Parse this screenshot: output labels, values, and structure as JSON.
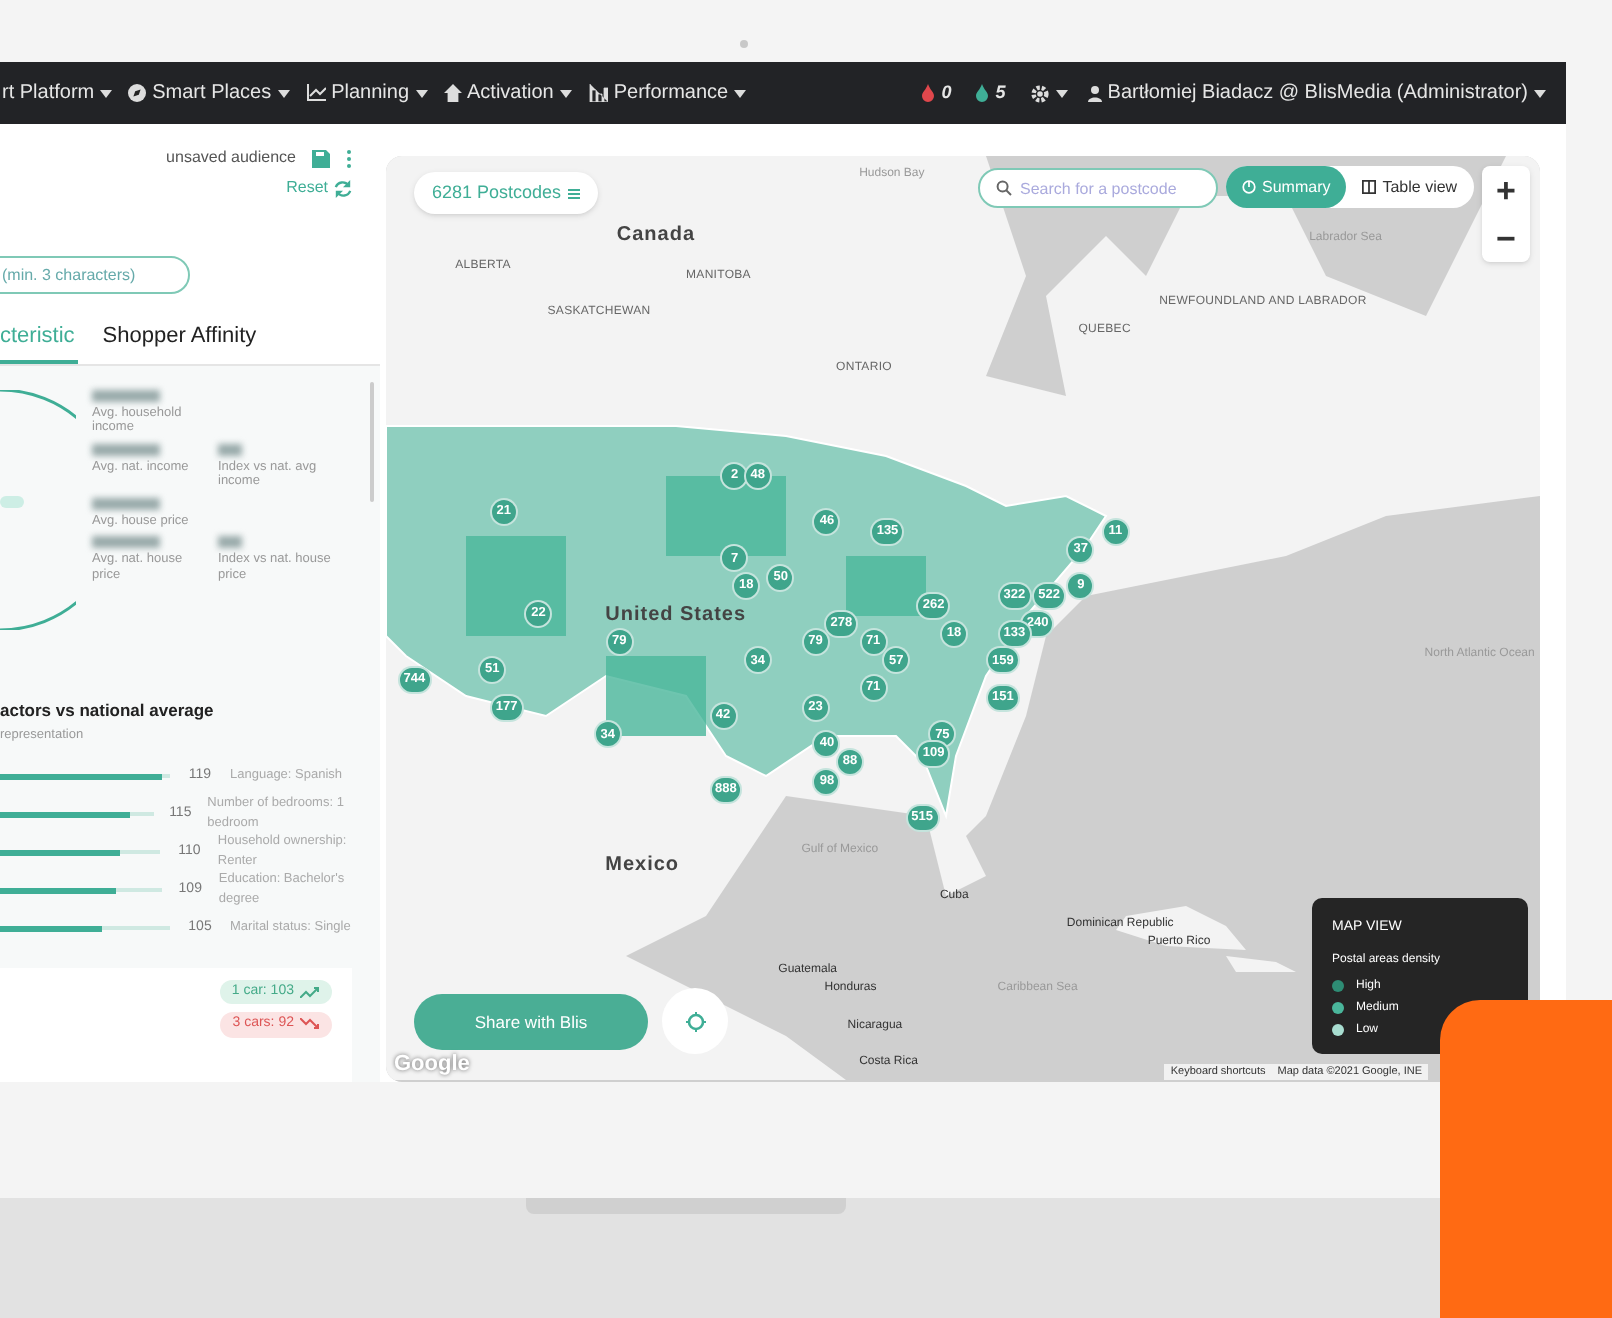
{
  "navbar": {
    "menus": [
      {
        "label": "rt Platform"
      },
      {
        "label": "Smart Places"
      },
      {
        "label": "Planning"
      },
      {
        "label": "Activation"
      },
      {
        "label": "Performance"
      }
    ],
    "counters": [
      {
        "count": "0",
        "color": "#e0474c"
      },
      {
        "count": "5",
        "color": "#3fae96"
      }
    ],
    "user": "Bartłomiej Biadacz @ BlisMedia (Administrator)"
  },
  "sidebar": {
    "audience_name": "unsaved audience",
    "reset": "Reset",
    "search": {
      "placeholder": "(min. 3 characters)"
    },
    "tabs": [
      {
        "label": "cteristic",
        "selected": true
      },
      {
        "label": "Shopper Affinity",
        "selected": false
      }
    ],
    "stats": [
      {
        "label": "Avg. household income"
      },
      {
        "label": "Avg. nat. income",
        "index_label": "Index vs nat. avg income"
      },
      {
        "label": "Avg. house price"
      },
      {
        "label": "Avg. nat. house price",
        "index_label": "Index vs nat. house price"
      }
    ],
    "factors_title": "actors vs national average",
    "factors_subtitle": "representation",
    "factors": [
      {
        "value": "119",
        "label": "Language: Spanish",
        "level": 0.95
      },
      {
        "value": "115",
        "label": "Number of bedrooms: 1 bedroom",
        "level": 0.85
      },
      {
        "value": "110",
        "label": "Household ownership: Renter",
        "level": 0.75
      },
      {
        "value": "109",
        "label": "Education: Bachelor's degree",
        "level": 0.72
      },
      {
        "value": "105",
        "label": "Marital status: Single",
        "level": 0.6
      }
    ],
    "badges": [
      {
        "text": "1 car: 103",
        "kind": "up"
      },
      {
        "text": "3 cars: 92",
        "kind": "down"
      }
    ]
  },
  "map": {
    "postcodes": "6281 Postcodes",
    "search": {
      "placeholder": "Search for a postcode"
    },
    "views": [
      {
        "label": "Summary",
        "selected": true
      },
      {
        "label": "Table view",
        "selected": false
      }
    ],
    "zoom": [
      "+",
      "−"
    ],
    "labels": [
      {
        "text": "Canada",
        "kind": "country"
      },
      {
        "text": "United States",
        "kind": "country"
      },
      {
        "text": "Mexico",
        "kind": "country"
      },
      {
        "text": "ALBERTA",
        "kind": "region"
      },
      {
        "text": "MANITOBA",
        "kind": "region"
      },
      {
        "text": "SASKATCHEWAN",
        "kind": "region"
      },
      {
        "text": "ONTARIO",
        "kind": "region"
      },
      {
        "text": "QUEBEC",
        "kind": "region"
      },
      {
        "text": "NEWFOUNDLAND AND LABRADOR",
        "kind": "region"
      },
      {
        "text": "Hudson Bay",
        "kind": "water"
      },
      {
        "text": "Labrador Sea",
        "kind": "water"
      },
      {
        "text": "Gulf of Mexico",
        "kind": "water"
      },
      {
        "text": "Caribbean Sea",
        "kind": "water"
      },
      {
        "text": "North Atlantic Ocean",
        "kind": "water"
      },
      {
        "text": "Cuba",
        "kind": "place"
      },
      {
        "text": "Dominican Republic",
        "kind": "place"
      },
      {
        "text": "Puerto Rico",
        "kind": "place"
      },
      {
        "text": "Guatemala",
        "kind": "place"
      },
      {
        "text": "Honduras",
        "kind": "place"
      },
      {
        "text": "Nicaragua",
        "kind": "place"
      },
      {
        "text": "Costa Rica",
        "kind": "place"
      }
    ],
    "clusters": [
      {
        "count": "2"
      },
      {
        "count": "48"
      },
      {
        "count": "21"
      },
      {
        "count": "46"
      },
      {
        "count": "135"
      },
      {
        "count": "7"
      },
      {
        "count": "18"
      },
      {
        "count": "50"
      },
      {
        "count": "11"
      },
      {
        "count": "37"
      },
      {
        "count": "22"
      },
      {
        "count": "79"
      },
      {
        "count": "34"
      },
      {
        "count": "79"
      },
      {
        "count": "278"
      },
      {
        "count": "71"
      },
      {
        "count": "262"
      },
      {
        "count": "322"
      },
      {
        "count": "522"
      },
      {
        "count": "9"
      },
      {
        "count": "240"
      },
      {
        "count": "18"
      },
      {
        "count": "133"
      },
      {
        "count": "57"
      },
      {
        "count": "159"
      },
      {
        "count": "744"
      },
      {
        "count": "51"
      },
      {
        "count": "71"
      },
      {
        "count": "151"
      },
      {
        "count": "177"
      },
      {
        "count": "23"
      },
      {
        "count": "42"
      },
      {
        "count": "34"
      },
      {
        "count": "75"
      },
      {
        "count": "40"
      },
      {
        "count": "109"
      },
      {
        "count": "88"
      },
      {
        "count": "98"
      },
      {
        "count": "888"
      },
      {
        "count": "515"
      }
    ],
    "share": "Share with Blis",
    "attribution": [
      {
        "text": "Keyboard shortcuts"
      },
      {
        "text": "Map data ©2021 Google, INE"
      }
    ],
    "logo": "Google",
    "legend": {
      "title": "MAP VIEW",
      "subtitle": "Postal areas density",
      "items": [
        {
          "label": "High",
          "color": "#2e8c74"
        },
        {
          "label": "Medium",
          "color": "#4ab69b"
        },
        {
          "label": "Low",
          "color": "#a8ddd0"
        }
      ]
    }
  }
}
